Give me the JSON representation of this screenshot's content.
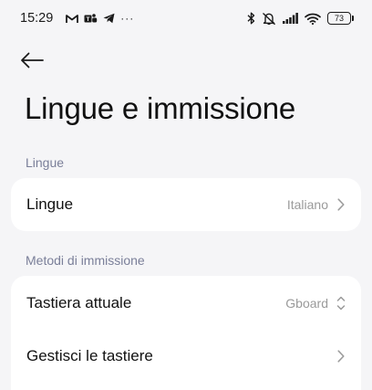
{
  "status_bar": {
    "time": "15:29",
    "more_dots": "···",
    "battery_level": "73",
    "icons_left": [
      "gmail-icon",
      "teams-icon",
      "telegram-icon"
    ],
    "icons_right": [
      "bluetooth-icon",
      "mute-icon",
      "signal-icon",
      "wifi-icon",
      "battery-icon"
    ]
  },
  "header": {
    "back_icon": "arrow-left-icon",
    "title": "Lingue e immissione"
  },
  "sections": [
    {
      "title": "Lingue",
      "rows": [
        {
          "label": "Lingue",
          "value": "Italiano",
          "icon": "chevron-right-icon"
        }
      ]
    },
    {
      "title": "Metodi di immissione",
      "rows": [
        {
          "label": "Tastiera attuale",
          "value": "Gboard",
          "icon": "chevron-up-down-icon"
        },
        {
          "label": "Gestisci le tastiere",
          "value": "",
          "icon": "chevron-right-icon"
        }
      ]
    }
  ],
  "colors": {
    "background": "#f5f5f7",
    "card": "#ffffff",
    "section_header": "#7a7f99",
    "secondary_text": "#9a9a9a"
  }
}
